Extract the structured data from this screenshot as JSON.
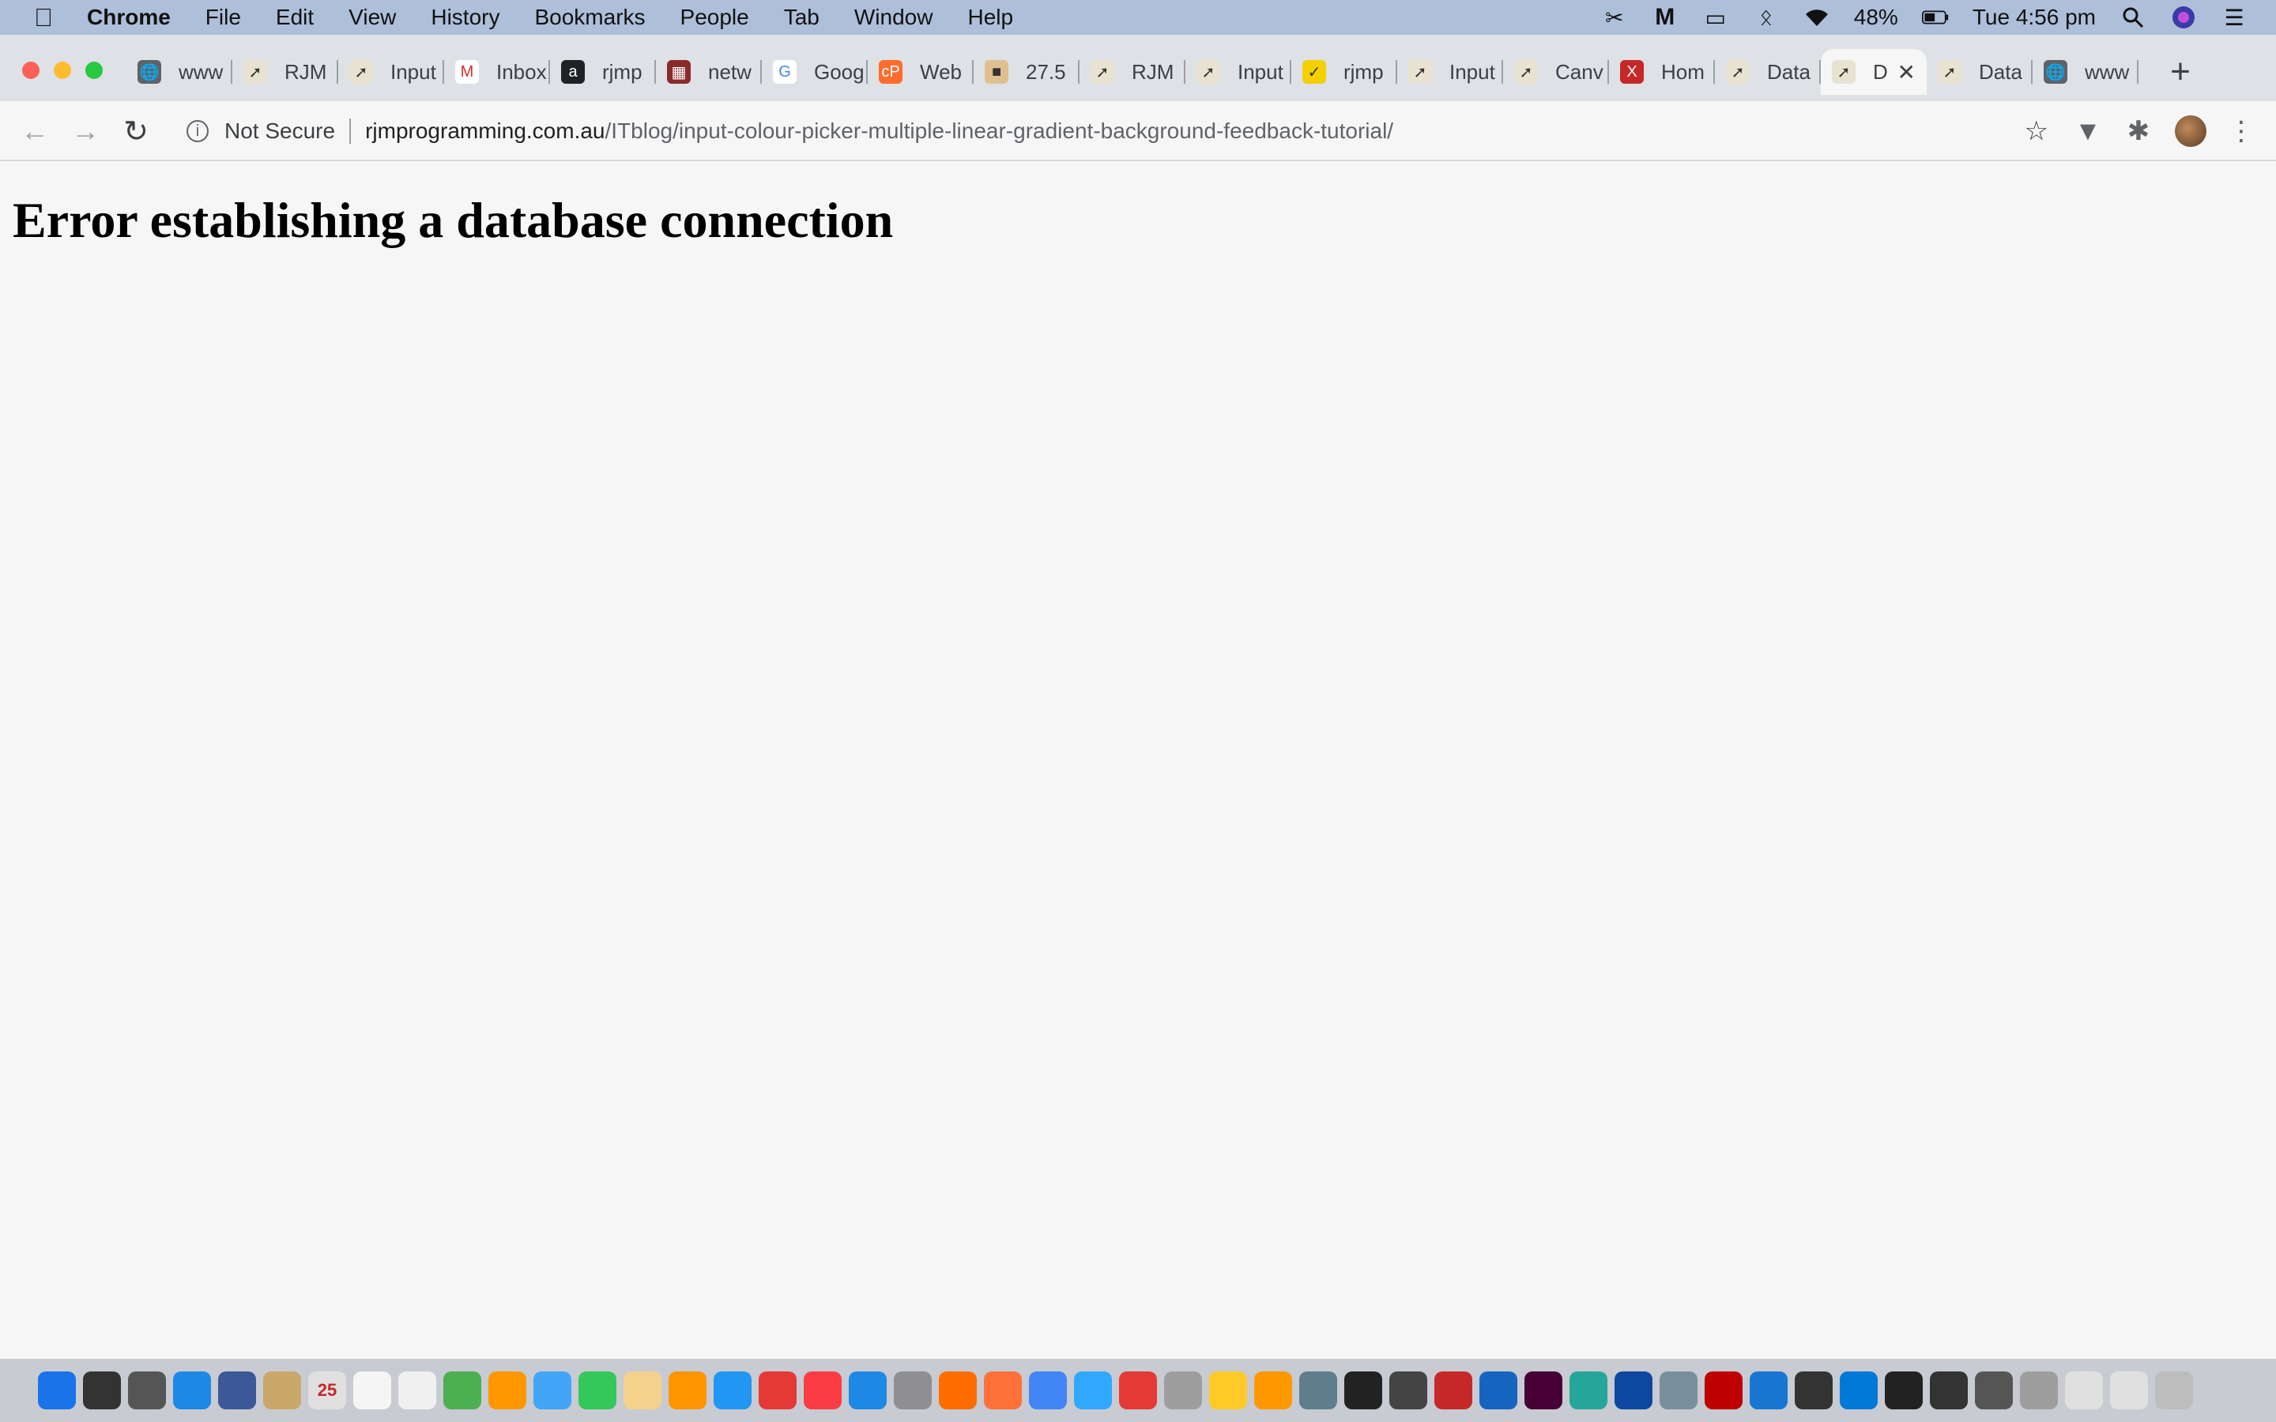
{
  "menubar": {
    "app_name": "Chrome",
    "items": [
      "File",
      "Edit",
      "View",
      "History",
      "Bookmarks",
      "People",
      "Tab",
      "Window",
      "Help"
    ],
    "battery": "48%",
    "clock": "Tue 4:56 pm"
  },
  "tabs": [
    {
      "title": "www",
      "icon": "globe-icon"
    },
    {
      "title": "RJM",
      "icon": "rjm-icon"
    },
    {
      "title": "Input",
      "icon": "rjm-icon"
    },
    {
      "title": "Inbox",
      "icon": "gmail-icon"
    },
    {
      "title": "rjmp",
      "icon": "a-icon"
    },
    {
      "title": "netw",
      "icon": "grid-icon"
    },
    {
      "title": "Goog",
      "icon": "google-icon"
    },
    {
      "title": "Web",
      "icon": "cpanel-icon"
    },
    {
      "title": "27.5",
      "icon": "chart-icon"
    },
    {
      "title": "RJM",
      "icon": "rjm-icon"
    },
    {
      "title": "Input",
      "icon": "rjm-icon"
    },
    {
      "title": "rjmp",
      "icon": "check-icon"
    },
    {
      "title": "Input",
      "icon": "rjm-icon"
    },
    {
      "title": "Canv",
      "icon": "rjm-icon"
    },
    {
      "title": "Hom",
      "icon": "x-icon"
    },
    {
      "title": "Data",
      "icon": "rjm-icon"
    },
    {
      "title": "D",
      "icon": "rjm-icon",
      "active": true
    },
    {
      "title": "Data",
      "icon": "rjm-icon"
    },
    {
      "title": "www",
      "icon": "globe-icon"
    }
  ],
  "toolbar": {
    "security_label": "Not Secure",
    "url_domain": "rjmprogramming.com.au",
    "url_path": "/ITblog/input-colour-picker-multiple-linear-gradient-background-feedback-tutorial/"
  },
  "page": {
    "heading": "Error establishing a database connection"
  },
  "dock": {
    "calendar_day": "25",
    "colors": [
      "#1a73e8",
      "#333",
      "#555",
      "#1e88e5",
      "#3b5998",
      "#c9a86a",
      "#e0e0e0",
      "#f5f5f5",
      "#f0f0f0",
      "#4caf50",
      "#ff9800",
      "#42a5f5",
      "#34c759",
      "#f5d28b",
      "#ff9500",
      "#2196f3",
      "#e53935",
      "#fc3c44",
      "#1e88e5",
      "#8e8e93",
      "#ff6d00",
      "#ff7139",
      "#4285f4",
      "#31a8ff",
      "#e53935",
      "#9e9e9e",
      "#ffca28",
      "#ff9800",
      "#607d8b",
      "#222",
      "#444",
      "#c62828",
      "#1565c0",
      "#470137",
      "#26a69a",
      "#0d47a1",
      "#78909c",
      "#bf0000",
      "#1976d2",
      "#333",
      "#0078d7",
      "#222",
      "#333",
      "#555",
      "#9e9e9e",
      "#e0e0e0",
      "#e0e0e0",
      "#bdbdbd"
    ]
  }
}
